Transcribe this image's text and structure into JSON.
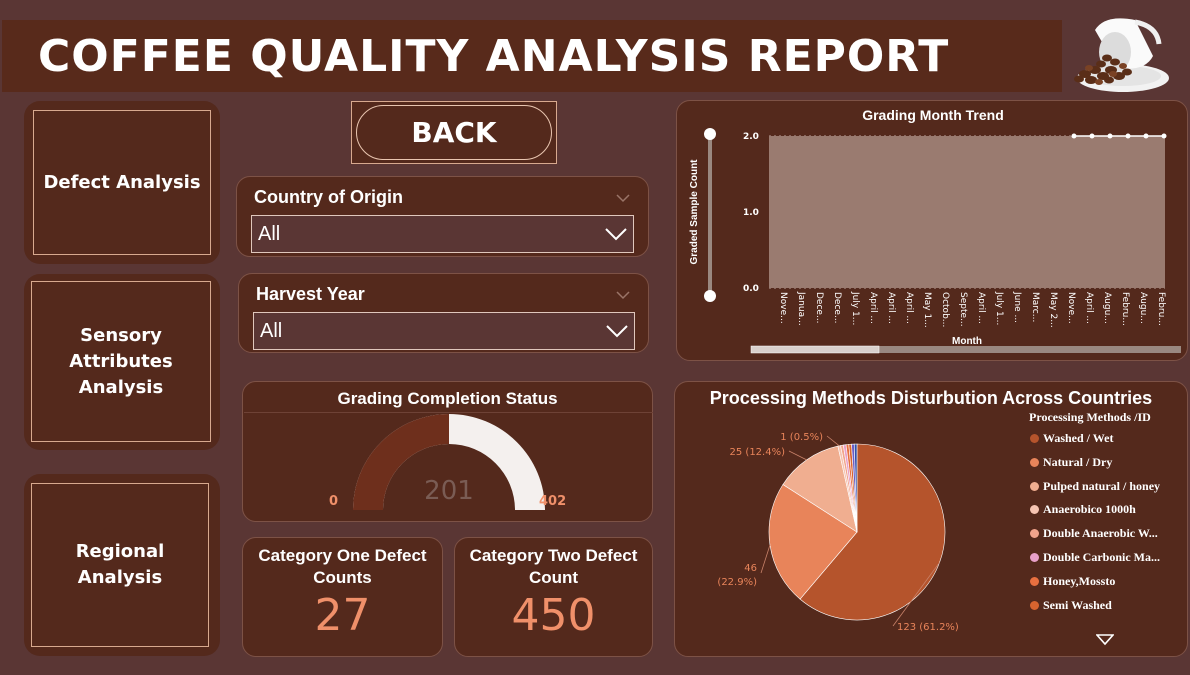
{
  "header": {
    "title": "COFFEE QUALITY ANALYSIS REPORT"
  },
  "nav": {
    "defect": "Defect Analysis",
    "sensory": [
      "Sensory",
      "Attributes",
      "Analysis"
    ],
    "regional": [
      "Regional",
      "Analysis"
    ]
  },
  "back_button": "BACK",
  "slicers": {
    "country": {
      "title": "Country of Origin",
      "value": "All"
    },
    "harvest": {
      "title": "Harvest Year",
      "value": "All"
    }
  },
  "gauge": {
    "title": "Grading Completion Status",
    "min": "0",
    "max": "402",
    "value": "201",
    "fraction": 0.5
  },
  "kpi": {
    "cat_one": {
      "title": [
        "Category One Defect",
        "Counts"
      ],
      "value": "27"
    },
    "cat_two": {
      "title": [
        "Category Two Defect",
        "Count"
      ],
      "value": "450"
    }
  },
  "colors": {
    "background": "#5a3634",
    "panel": "#54291c",
    "accent": "#f0906a",
    "area": "#9a7b70"
  },
  "chart_data": [
    {
      "type": "area",
      "title": "Grading Month Trend",
      "xlabel": "Month",
      "ylabel": "Graded Sample Count",
      "ylim": [
        0,
        2
      ],
      "yticks": [
        "0.0",
        "1.0",
        "2.0"
      ],
      "categories": [
        "Nove...",
        "Janua...",
        "Dece...",
        "Dece...",
        "July 1...",
        "April ...",
        "April ...",
        "April ...",
        "May 1...",
        "Octob...",
        "Septe...",
        "April ...",
        "July 1...",
        "June ...",
        "Marc...",
        "May 2...",
        "Nove...",
        "April ...",
        "Augu...",
        "Febru...",
        "Augu...",
        "Febru..."
      ],
      "values": [
        2,
        2,
        2,
        2,
        2,
        2,
        2,
        2,
        2,
        2,
        2,
        2,
        2,
        2,
        2,
        2,
        2,
        2,
        2,
        2,
        2,
        2
      ],
      "grid": true
    },
    {
      "type": "pie",
      "title": "Processing Methods Disturbution Across Countries",
      "legend_title": "Processing Methods /ID",
      "legend_position": "right",
      "slices": [
        {
          "name": "Washed / Wet",
          "value": 123,
          "label": "123 (61.2%)",
          "color": "#b5542c"
        },
        {
          "name": "Natural / Dry",
          "value": 46,
          "label": "46 (22.9%)",
          "color": "#e8845a"
        },
        {
          "name": "Pulped natural / honey",
          "value": 25,
          "label": "25 (12.4%)",
          "color": "#f0ae90"
        },
        {
          "name": "Anaerobico 1000h",
          "value": 1,
          "label": "1 (0.5%)",
          "color": "#f6c4b2"
        },
        {
          "name": "Double Anaerobic W...",
          "value": 1,
          "label": "",
          "color": "#f2a48c"
        },
        {
          "name": "Double Carbonic Ma...",
          "value": 1,
          "label": "",
          "color": "#e8a0c8"
        },
        {
          "name": "Honey,Mossto",
          "value": 1,
          "label": "",
          "color": "#e87040"
        },
        {
          "name": "Semi Washed",
          "value": 1,
          "label": "",
          "color": "#d8642f"
        },
        {
          "name": "",
          "value": 1,
          "label": "",
          "color": "#6c5cc4"
        },
        {
          "name": "",
          "value": 1,
          "label": "",
          "color": "#3050a8"
        }
      ]
    }
  ]
}
